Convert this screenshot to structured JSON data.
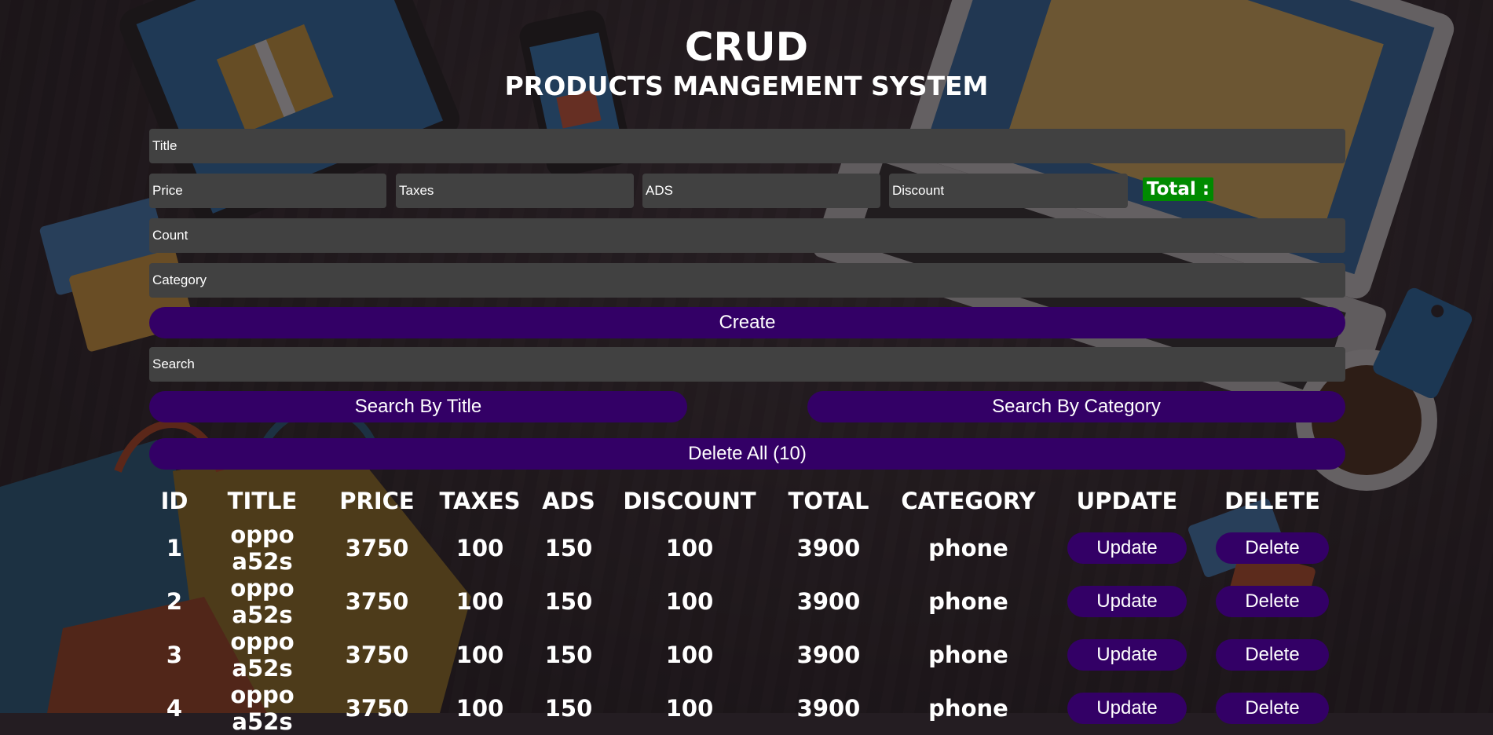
{
  "header": {
    "title": "CRUD",
    "subtitle": "PRODUCTS MANGEMENT SYSTEM"
  },
  "form": {
    "title_placeholder": "Title",
    "price_placeholder": "Price",
    "taxes_placeholder": "Taxes",
    "ads_placeholder": "ADS",
    "discount_placeholder": "Discount",
    "total_label": "Total :",
    "count_placeholder": "Count",
    "category_placeholder": "Category",
    "create_label": "Create"
  },
  "search": {
    "placeholder": "Search",
    "by_title_label": "Search By Title",
    "by_category_label": "Search By Category"
  },
  "delete_all_label": "Delete All (10)",
  "table": {
    "columns": [
      "ID",
      "TITLE",
      "PRICE",
      "TAXES",
      "ADS",
      "DISCOUNT",
      "TOTAL",
      "CATEGORY",
      "UPDATE",
      "DELETE"
    ],
    "update_label": "Update",
    "delete_label": "Delete",
    "rows": [
      {
        "id": "1",
        "title": "oppo a52s",
        "price": "3750",
        "taxes": "100",
        "ads": "150",
        "discount": "100",
        "total": "3900",
        "category": "phone"
      },
      {
        "id": "2",
        "title": "oppo a52s",
        "price": "3750",
        "taxes": "100",
        "ads": "150",
        "discount": "100",
        "total": "3900",
        "category": "phone"
      },
      {
        "id": "3",
        "title": "oppo a52s",
        "price": "3750",
        "taxes": "100",
        "ads": "150",
        "discount": "100",
        "total": "3900",
        "category": "phone"
      },
      {
        "id": "4",
        "title": "oppo a52s",
        "price": "3750",
        "taxes": "100",
        "ads": "150",
        "discount": "100",
        "total": "3900",
        "category": "phone"
      }
    ]
  },
  "colors": {
    "button": "#330066",
    "input": "#414141",
    "total_badge": "#008a00"
  }
}
